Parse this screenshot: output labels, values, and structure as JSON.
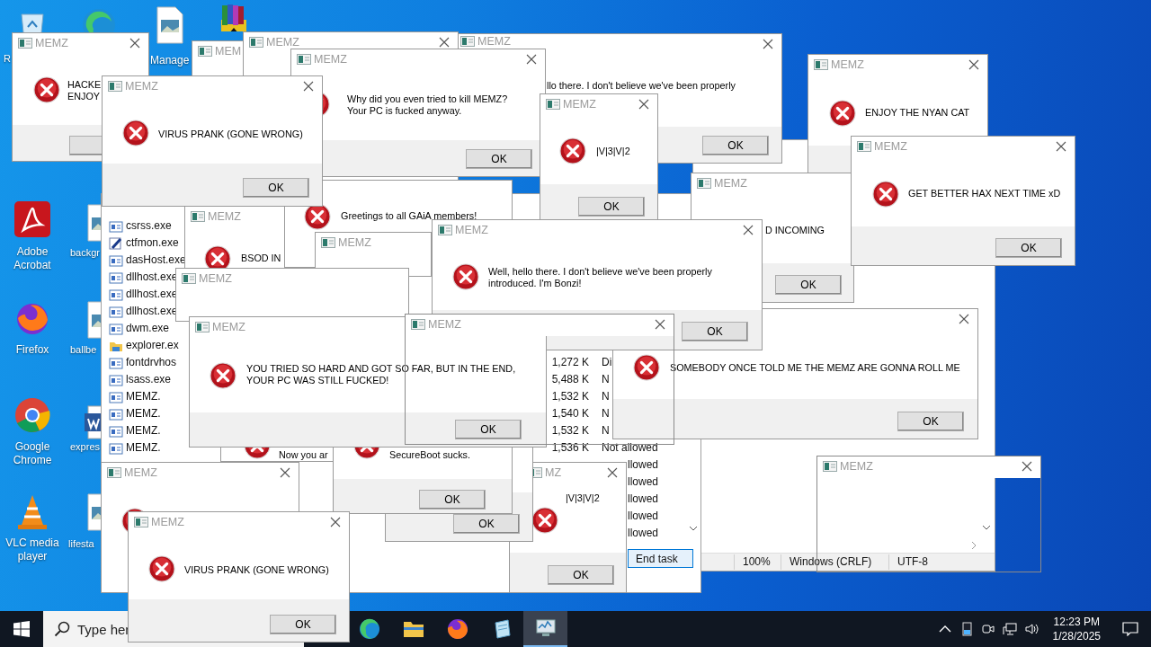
{
  "desktop_icons": [
    {
      "kind": "recycle_bin",
      "label": "R"
    },
    {
      "kind": "edge"
    },
    {
      "kind": "image_file",
      "label": "Manage"
    },
    {
      "kind": "winrar"
    },
    {
      "kind": "pdf",
      "label": "Adobe Acrobat"
    },
    {
      "kind": "image_file",
      "label": "backgr"
    },
    {
      "kind": "firefox",
      "label": "Firefox"
    },
    {
      "kind": "image_file",
      "label": "ballbe"
    },
    {
      "kind": "chrome",
      "label": "Google Chrome"
    },
    {
      "kind": "word",
      "label": "expres"
    },
    {
      "kind": "vlc",
      "label": "VLC media player"
    },
    {
      "kind": "image_file",
      "label": "lifesta"
    }
  ],
  "notepad": {
    "status_bar": [
      "100%",
      "Windows (CRLF)",
      "UTF-8"
    ]
  },
  "task_manager": {
    "rows": [
      {
        "kind": "app",
        "name": "csrss.exe"
      },
      {
        "kind": "pen",
        "name": "ctfmon.exe"
      },
      {
        "kind": "app",
        "name": "dasHost.exe"
      },
      {
        "kind": "app",
        "name": "dllhost.exe"
      },
      {
        "kind": "app",
        "name": "dllhost.exe"
      },
      {
        "kind": "app",
        "name": "dllhost.exe"
      },
      {
        "kind": "app",
        "name": "dwm.exe"
      },
      {
        "kind": "folder",
        "name": "explorer.ex"
      },
      {
        "kind": "app",
        "name": "fontdrvhos",
        "memory": "1,272 K",
        "status": "Di"
      },
      {
        "kind": "app",
        "name": "lsass.exe",
        "memory": "5,488 K",
        "status": "N"
      },
      {
        "kind": "app",
        "name": "MEMZ.",
        "memory": "1,532 K",
        "status": "N"
      },
      {
        "kind": "app",
        "name": "MEMZ.",
        "memory": "1,540 K",
        "status": "N"
      },
      {
        "kind": "app",
        "name": "MEMZ.",
        "memory": "1,532 K",
        "status": "N"
      },
      {
        "kind": "app",
        "name": "MEMZ.",
        "memory": "1,536 K",
        "status": "Not allowed"
      },
      {
        "status": "llowed"
      },
      {
        "status": "llowed"
      },
      {
        "status": "llowed"
      },
      {
        "status": "llowed"
      },
      {
        "status": "llowed"
      }
    ],
    "end_task_button": "End task"
  },
  "windows": [
    {
      "kind": "dialog",
      "title": "MEMZ",
      "message": [
        "HACKE",
        "ENJOY"
      ]
    },
    {
      "kind": "dialog",
      "title": "MEM"
    },
    {
      "kind": "dialog",
      "title": "MEMZ"
    },
    {
      "kind": "dialog",
      "title": "MEMZ",
      "message": [
        "Why did you even tried to kill MEMZ?",
        "Your PC is fucked anyway."
      ],
      "button": "OK"
    },
    {
      "kind": "dialog",
      "title": "MEMZ",
      "message": [
        "llo there. I don't believe we've been properly"
      ],
      "button": "OK"
    },
    {
      "kind": "dialog",
      "title": "MEMZ",
      "message": [
        "ENJOY THE NYAN CAT"
      ]
    },
    {
      "kind": "dialog",
      "title": "MEMZ",
      "message": [
        "VIRUS PRANK (GONE WRONG)"
      ],
      "button": "OK"
    },
    {
      "kind": "dialog",
      "title": "MEMZ",
      "message": [
        "|V|3|V|2"
      ],
      "button": "OK"
    },
    {
      "kind": "dialog",
      "title": "MEMZ",
      "message": [
        "GET BETTER HAX NEXT TIME xD"
      ],
      "button": "OK"
    },
    {
      "kind": "dialog",
      "title": "MEMZ",
      "message": [
        "BSOD IN"
      ]
    },
    {
      "kind": "dialog",
      "message": [
        "Greetings to all GAiA members!"
      ]
    },
    {
      "kind": "dialog",
      "title": "MEMZ"
    },
    {
      "kind": "dialog",
      "title": "MEMZ",
      "message": [
        "Well, hello there. I don't believe we've been properly",
        "introduced. I'm Bonzi!"
      ],
      "button": "OK"
    },
    {
      "kind": "dialog",
      "title": "MEMZ",
      "message": [
        "D INCOMING"
      ],
      "button": "OK"
    },
    {
      "kind": "dialog",
      "title": "MEMZ"
    },
    {
      "kind": "dialog",
      "title": "MEMZ",
      "message": [
        "YOU TRIED SO HARD AND GOT SO FAR, BUT IN THE END,",
        "YOUR PC WAS STILL FUCKED!"
      ],
      "button": "OK"
    },
    {
      "kind": "frame",
      "title": "MEMZ"
    },
    {
      "kind": "dialog",
      "message": [
        "SOMEBODY ONCE TOLD ME THE MEMZ ARE GONNA ROLL ME"
      ],
      "button": "OK"
    },
    {
      "kind": "dialog",
      "title": "MEMZ"
    },
    {
      "kind": "dialog",
      "message": [
        "Now you ar"
      ]
    },
    {
      "kind": "dialog",
      "message": [
        "SecureBoot sucks."
      ],
      "button": "OK"
    },
    {
      "kind": "dialog",
      "button": "OK"
    },
    {
      "kind": "dialog",
      "title": "MZ",
      "message": [
        "|V|3|V|2"
      ],
      "button": "OK"
    },
    {
      "kind": "frame",
      "title": "MEMZ"
    },
    {
      "kind": "dialog",
      "title": "MEMZ",
      "message": [
        "VIRUS PRANK (GONE WRONG)"
      ],
      "button": "OK"
    }
  ],
  "taskbar": {
    "search": {
      "placeholder": "Type her"
    },
    "apps": [
      {
        "kind": "edge",
        "selected": false
      },
      {
        "kind": "folder",
        "selected": false
      },
      {
        "kind": "firefox",
        "selected": false
      },
      {
        "kind": "notepad",
        "selected": false
      },
      {
        "kind": "monitor",
        "selected": true
      }
    ],
    "time": "12:23 PM",
    "date": "1/28/2025"
  }
}
